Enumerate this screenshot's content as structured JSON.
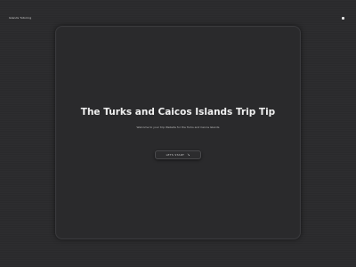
{
  "header": {
    "brand": "Islands Tutoring",
    "menu_icon": "square-dot-icon"
  },
  "hero": {
    "title": "The Turks and Caicos Islands Trip Tip",
    "subtitle": "Welcome to your trip Website for the Turks and Caicos Islands",
    "start_button_label": "LETS START",
    "start_button_icon": "arrow-down-icon"
  },
  "colors": {
    "background": "#2b2b2d",
    "card": "#2a2a2c",
    "text": "#f0f0f0"
  }
}
